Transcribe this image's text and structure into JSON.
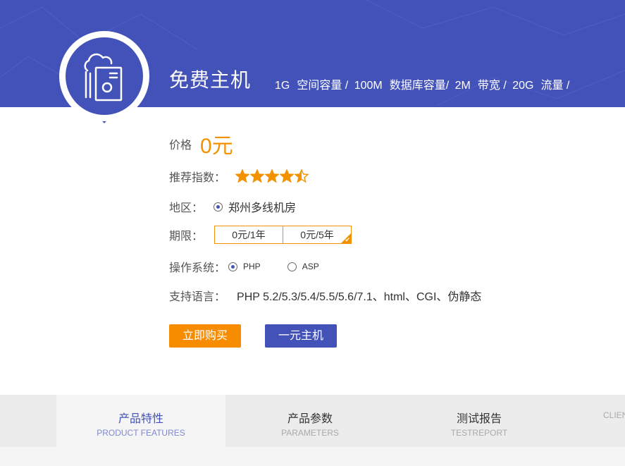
{
  "product": {
    "title": "免费主机",
    "specs": [
      {
        "value": "1G",
        "label": "空间容量 /"
      },
      {
        "value": "100M",
        "label": "数据库容量/"
      },
      {
        "value": "2M",
        "label": "带宽 /"
      },
      {
        "value": "20G",
        "label": "流量 /"
      }
    ]
  },
  "price": {
    "label": "价格",
    "amount": "0元"
  },
  "rating": {
    "label": "推荐指数：",
    "value": 4.5,
    "max": 5
  },
  "region": {
    "label": "地区：",
    "selected": "郑州多线机房"
  },
  "period": {
    "label": "期限：",
    "options": [
      {
        "text": "0元/1年",
        "selected": false
      },
      {
        "text": "0元/5年",
        "selected": true
      }
    ]
  },
  "os": {
    "label": "操作系统：",
    "options": [
      {
        "text": "PHP",
        "selected": true
      },
      {
        "text": "ASP",
        "selected": false
      }
    ]
  },
  "language": {
    "label": "支持语言：",
    "value": "PHP 5.2/5.3/5.4/5.5/5.6/7.1、html、CGI、伪静态"
  },
  "buttons": {
    "buy": "立即购买",
    "one_yuan": "一元主机"
  },
  "tabs": [
    {
      "cn": "产品特性",
      "en": "PRODUCT FEATURES",
      "active": true
    },
    {
      "cn": "产品参数",
      "en": "PARAMETERS",
      "active": false
    },
    {
      "cn": "测试报告",
      "en": "TESTREPORT",
      "active": false
    },
    {
      "cn": "",
      "en": "CLIEN",
      "active": false
    }
  ],
  "colors": {
    "brand_blue": "#4352b8",
    "accent_orange": "#f39200",
    "star": "#f39200"
  }
}
